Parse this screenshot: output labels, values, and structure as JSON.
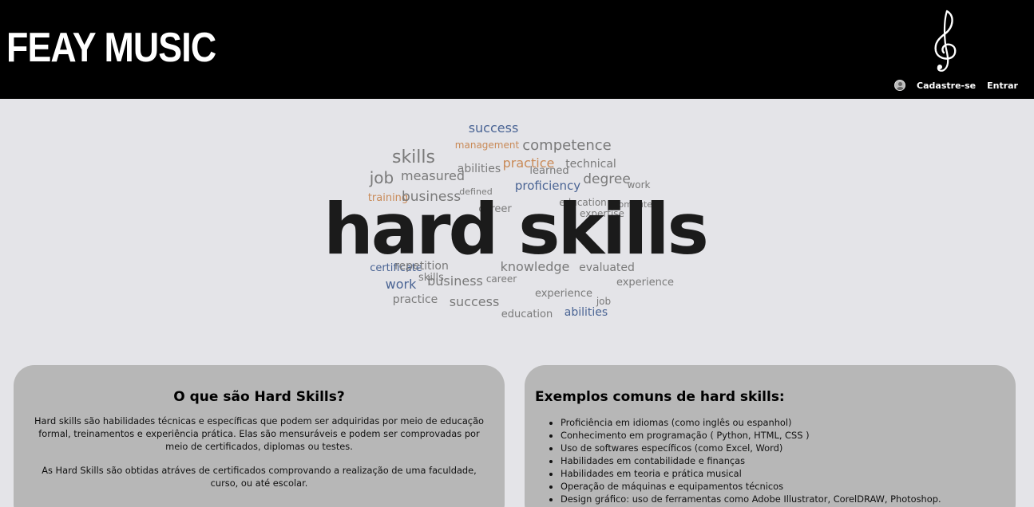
{
  "header": {
    "brand": "FEAY MUSIC",
    "clef_icon": "treble-clef-icon",
    "avatar_icon": "user-avatar-icon",
    "signup_label": "Cadastre-se",
    "login_label": "Entrar"
  },
  "hero": {
    "title": "hard skills",
    "cloud_words": [
      "success",
      "management",
      "competence",
      "skills",
      "job",
      "measured",
      "abilities",
      "practice",
      "technical",
      "learned",
      "degree",
      "proficiency",
      "training",
      "business",
      "work",
      "career",
      "defined",
      "education",
      "computer",
      "expertise",
      "certificate",
      "repetition",
      "knowledge",
      "evaluated",
      "experience",
      "skills",
      "work",
      "business",
      "practice",
      "success",
      "experience",
      "abilities",
      "education",
      "job",
      "career"
    ]
  },
  "card_left": {
    "title": "O que são Hard Skills?",
    "paragraphs": [
      "Hard skills são habilidades técnicas e específicas que podem ser adquiridas por meio de educação formal, treinamentos e experiência prática. Elas são mensuráveis e podem ser comprovadas por meio de certificados, diplomas ou testes.",
      "As Hard Skills são obtidas atráves de certificados comprovando a realização de uma faculdade, curso, ou até escolar."
    ]
  },
  "card_right": {
    "title": "Exemplos comuns de hard skills:",
    "items": [
      "Proficiência em idiomas (como inglês ou espanhol)",
      "Conhecimento em programação ( Python, HTML, CSS )",
      "Uso de softwares específicos (como Excel, Word)",
      "Habilidades em contabilidade e finanças",
      "Habilidades em teoria e prática musical",
      "Operação de máquinas e equipamentos técnicos",
      "Design gráfico: uso de ferramentas como Adobe Illustrator, CorelDRAW, Photoshop."
    ]
  },
  "colors": {
    "header_bg": "#000000",
    "page_bg": "#e4e4e8",
    "card_bg": "#b7b7b7",
    "cloud_blue": "#4a6494",
    "cloud_orange": "#c98a57",
    "cloud_gray": "#7a7a7a"
  }
}
